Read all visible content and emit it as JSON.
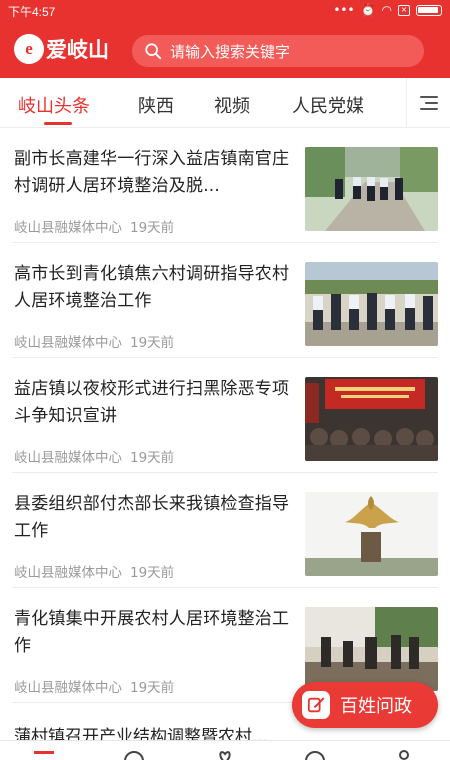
{
  "status_bar": {
    "time": "下午4:57"
  },
  "header": {
    "logo_mark": "e",
    "app_name": "爱岐山",
    "search_placeholder": "请输入搜索关键字"
  },
  "tabs": [
    {
      "label": "岐山头条",
      "active": true
    },
    {
      "label": "陕西",
      "active": false
    },
    {
      "label": "视频",
      "active": false
    },
    {
      "label": "人民党媒",
      "active": false
    }
  ],
  "news": [
    {
      "title": "副市长高建华一行深入益店镇南官庄村调研人居环境整治及脱...",
      "source": "岐山县融媒体中心",
      "ago": "19天前"
    },
    {
      "title": "高市长到青化镇焦六村调研指导农村人居环境整治工作",
      "source": "岐山县融媒体中心",
      "ago": "19天前"
    },
    {
      "title": "益店镇以夜校形式进行扫黑除恶专项斗争知识宣讲",
      "source": "岐山县融媒体中心",
      "ago": "19天前"
    },
    {
      "title": "县委组织部付杰部长来我镇检查指导工作",
      "source": "岐山县融媒体中心",
      "ago": "19天前"
    },
    {
      "title": "青化镇集中开展农村人居环境整治工作",
      "source": "岐山县融媒体中心",
      "ago": "19天前"
    }
  ],
  "peek_title": "蒲村镇召开产业结构调整暨农村...",
  "fab": {
    "label": "百姓问政"
  },
  "colors": {
    "brand": "#e8322f",
    "meta": "#9a9a9a"
  }
}
